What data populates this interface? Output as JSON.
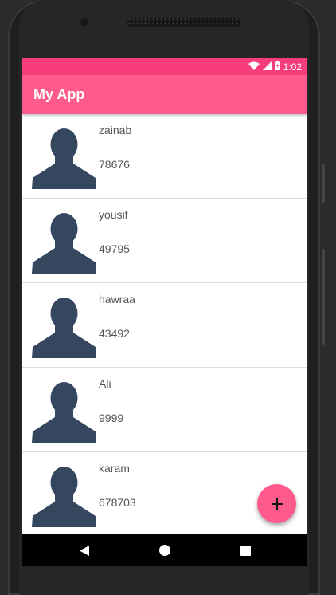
{
  "status": {
    "time": "1:02",
    "icons": [
      "wifi-icon",
      "signal-icon",
      "battery-icon"
    ]
  },
  "appbar": {
    "title": "My App"
  },
  "contacts": [
    {
      "name": "zainab",
      "number": "78676"
    },
    {
      "name": "yousif",
      "number": "49795"
    },
    {
      "name": "hawraa",
      "number": "43492"
    },
    {
      "name": "Ali",
      "number": "9999"
    },
    {
      "name": "karam",
      "number": "678703"
    }
  ],
  "fab": {
    "icon": "plus-icon"
  },
  "navigation": {
    "buttons": [
      "back-icon",
      "home-icon",
      "recents-icon"
    ]
  },
  "colors": {
    "status_bar": "#f73e7b",
    "app_bar": "#ff5a8c",
    "avatar": "#34475f",
    "accent": "#ff5a8c"
  }
}
